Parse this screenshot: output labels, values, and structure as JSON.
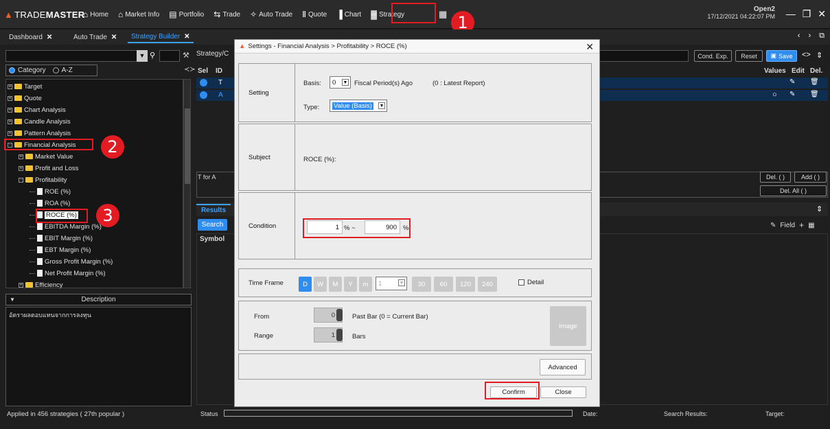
{
  "app": {
    "brand_prefix": "TRADE",
    "brand_bold": "MASTER"
  },
  "menu": [
    {
      "icon": "home-icon",
      "glyph": "⌂",
      "label": "Home"
    },
    {
      "icon": "bank-icon",
      "glyph": "⌂",
      "label": "Market Info"
    },
    {
      "icon": "briefcase-icon",
      "glyph": "▤",
      "label": "Portfolio"
    },
    {
      "icon": "trade-icon",
      "glyph": "⇆",
      "label": "Trade"
    },
    {
      "icon": "auto-trade-icon",
      "glyph": "✧",
      "label": "Auto Trade"
    },
    {
      "icon": "quote-icon",
      "glyph": "Ⅱ",
      "label": "Quote"
    },
    {
      "icon": "chart-icon",
      "glyph": "▐",
      "label": "Chart"
    },
    {
      "icon": "strategy-icon",
      "glyph": "▓",
      "label": "Strategy"
    }
  ],
  "account": {
    "name": "Open2",
    "datetime": "17/12/2021 04:22:07 PM"
  },
  "callouts": {
    "one": "1",
    "two": "2",
    "three": "3"
  },
  "tabs": [
    {
      "label": "Dashboard"
    },
    {
      "label": "Auto Trade"
    },
    {
      "label": "Strategy Builder",
      "active": true
    }
  ],
  "left": {
    "category_label": "Category",
    "az_label": "A-Z",
    "tree": [
      {
        "label": "Target",
        "type": "folder",
        "level": 0
      },
      {
        "label": "Quote",
        "type": "folder",
        "level": 0
      },
      {
        "label": "Chart Analysis",
        "type": "folder",
        "level": 0
      },
      {
        "label": "Candle Analysis",
        "type": "folder",
        "level": 0
      },
      {
        "label": "Pattern Analysis",
        "type": "folder",
        "level": 0
      },
      {
        "label": "Financial Analysis",
        "type": "folder",
        "level": 0,
        "expanded": true
      },
      {
        "label": "Market Value",
        "type": "folder",
        "level": 1
      },
      {
        "label": "Profit and Loss",
        "type": "folder",
        "level": 1
      },
      {
        "label": "Profitability",
        "type": "folder",
        "level": 1,
        "expanded": true
      },
      {
        "label": "ROE (%)",
        "type": "doc",
        "level": 2
      },
      {
        "label": "ROA (%)",
        "type": "doc",
        "level": 2
      },
      {
        "label": "ROCE (%)",
        "type": "doc",
        "level": 2,
        "selected": true
      },
      {
        "label": "EBITDA Margin (%)",
        "type": "doc",
        "level": 2
      },
      {
        "label": "EBIT Margin (%)",
        "type": "doc",
        "level": 2
      },
      {
        "label": "EBT Margin (%)",
        "type": "doc",
        "level": 2
      },
      {
        "label": "Gross Profit Margin (%)",
        "type": "doc",
        "level": 2
      },
      {
        "label": "Net Profit Margin (%)",
        "type": "doc",
        "level": 2
      },
      {
        "label": "Efficiency",
        "type": "folder",
        "level": 1
      }
    ],
    "description_header": "Description",
    "description_text": "อัตราผลตอบแทนจากการลงทุน",
    "status": "Applied in 456 strategies ( 27th popular )"
  },
  "main": {
    "strategy_label": "Strategy/C",
    "cond_exp": "Cond. Exp.",
    "reset": "Reset",
    "save": "Save",
    "headers": {
      "sel": "Sel",
      "id": "ID",
      "values": "Values",
      "edit": "Edit",
      "del": "Del."
    },
    "rows": [
      {
        "id": "T"
      },
      {
        "id": "A"
      }
    ],
    "t_for_a": "T for A",
    "del_paren": "Del. ( )",
    "add_paren": "Add ( )",
    "del_all": "Del. All ( )",
    "results_tab": "Results",
    "search": "Search",
    "symbol": "Symbol",
    "field": "Field",
    "status_label": "Status",
    "date_label": "Date:",
    "search_results_label": "Search Results:",
    "target_label": "Target:"
  },
  "dialog": {
    "title": "Settings - Financial Analysis > Profitability > ROCE (%)",
    "setting_label": "Setting",
    "basis_label": "Basis:",
    "basis_value": "0",
    "fiscal_text": "Fiscal Period(s) Ago",
    "latest_text": "(0 : Latest Report)",
    "type_label": "Type:",
    "type_value": "Value (Basis)",
    "subject_label": "Subject",
    "subject_value": "ROCE (%):",
    "condition_label": "Condition",
    "cond_from": "1",
    "cond_from_unit": "% ~",
    "cond_to": "900",
    "cond_to_unit": "%",
    "timeframe_label": "Time Frame",
    "tf_buttons": [
      "D",
      "W",
      "M",
      "Y",
      "m"
    ],
    "tf_minute_value": "1",
    "tf_minutes": [
      "30",
      "60",
      "120",
      "240"
    ],
    "detail_label": "Detail",
    "from_label": "From",
    "from_value": "0",
    "from_hint": "Past Bar (0 = Current Bar)",
    "range_label": "Range",
    "range_value": "1",
    "range_unit": "Bars",
    "image_btn": "Image",
    "advanced_btn": "Advanced",
    "confirm_btn": "Confirm",
    "close_btn": "Close"
  }
}
